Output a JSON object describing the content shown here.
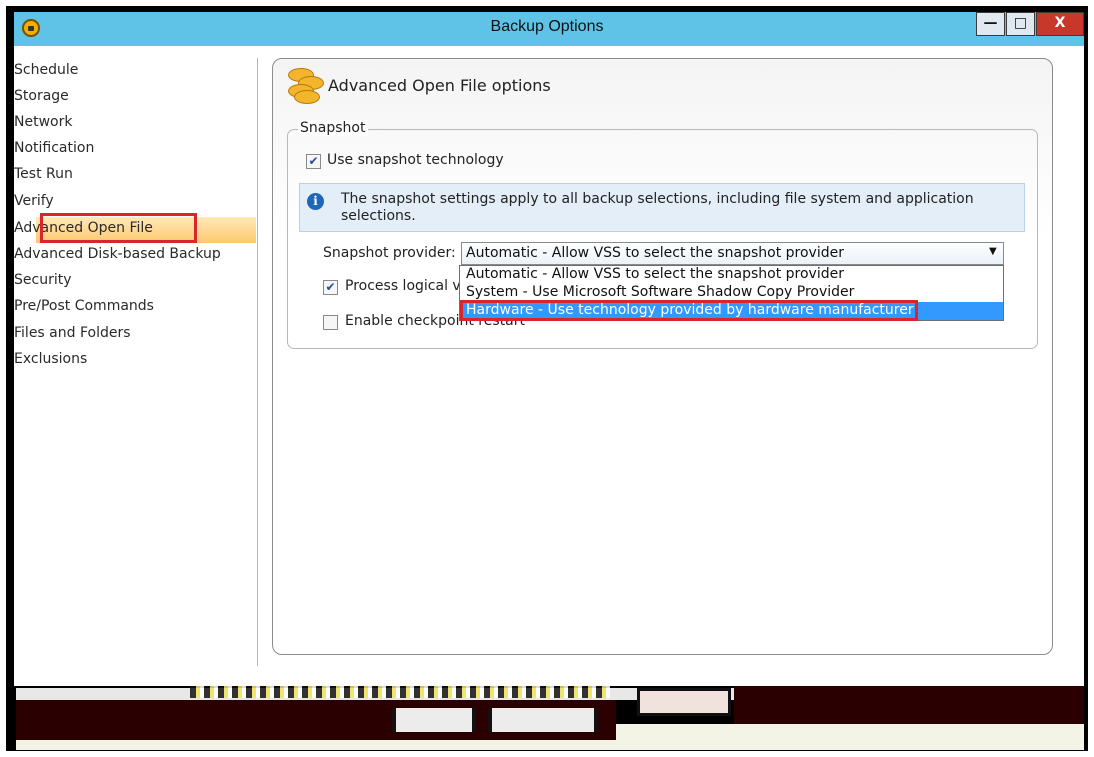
{
  "window": {
    "title": "Backup Options",
    "controls": {
      "minimize": "—",
      "maximize": "□",
      "close": "X"
    }
  },
  "nav": {
    "items": [
      {
        "label": "Schedule"
      },
      {
        "label": "Storage"
      },
      {
        "label": "Network"
      },
      {
        "label": "Notification"
      },
      {
        "label": "Test Run"
      },
      {
        "label": "Verify"
      },
      {
        "label": "Advanced Open File"
      },
      {
        "label": "Advanced Disk-based Backup"
      },
      {
        "label": "Security"
      },
      {
        "label": "Pre/Post Commands"
      },
      {
        "label": "Files and Folders"
      },
      {
        "label": "Exclusions"
      }
    ],
    "selected": "Advanced Open File"
  },
  "panel": {
    "icon": "coins-icon",
    "title": "Advanced Open File options"
  },
  "snapshot": {
    "group_label": "Snapshot",
    "use_snapshot": {
      "label": "Use snapshot technology",
      "checked": true
    },
    "info": {
      "icon": "info-icon",
      "text": "The snapshot settings apply to all backup selections, including file system and application selections."
    },
    "provider": {
      "label": "Snapshot provider:",
      "value": "Automatic - Allow VSS to select the snapshot provider",
      "options": [
        "Automatic - Allow VSS to select the snapshot provider",
        "System - Use Microsoft Software Shadow Copy Provider",
        "Hardware - Use technology provided by hardware manufacturer"
      ],
      "highlighted": "Hardware - Use technology provided by hardware manufacturer"
    },
    "process_logical": {
      "label": "Process logical v",
      "checked": true
    },
    "checkpoint_restart": {
      "label": "Enable checkpoint restart",
      "checked": false
    }
  },
  "colors": {
    "titlebar": "#5ec3e7",
    "highlight_box": "#d9262a",
    "selection_blue": "#3399ff"
  }
}
